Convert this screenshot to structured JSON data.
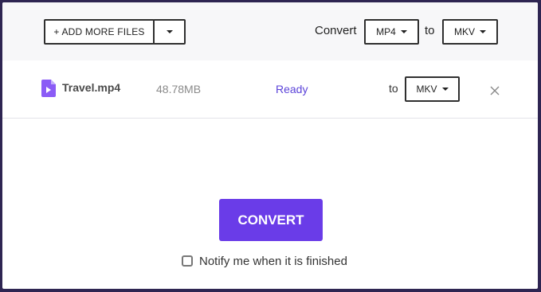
{
  "toolbar": {
    "add_files_label": "+ ADD MORE FILES",
    "convert_label": "Convert",
    "from_format": "MP4",
    "to_label": "to",
    "to_format": "MKV"
  },
  "files": [
    {
      "name": "Travel.mp4",
      "size": "48.78MB",
      "status": "Ready",
      "to_label": "to",
      "target_format": "MKV"
    }
  ],
  "actions": {
    "convert_button": "CONVERT",
    "notify_label": "Notify me when it is finished"
  },
  "colors": {
    "accent": "#6a3ce8",
    "status_ready": "#5b43d9",
    "file_icon": "#8b5cf6",
    "outer_border": "#2e2552"
  }
}
